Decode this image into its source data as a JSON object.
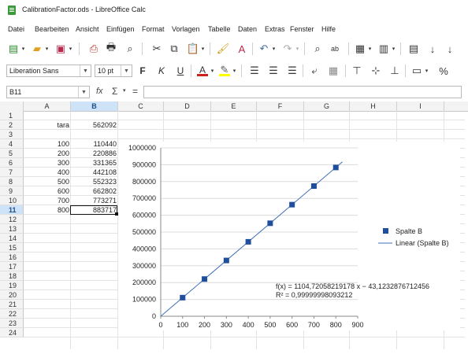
{
  "window": {
    "title": "CalibrationFactor.ods - LibreOffice Calc"
  },
  "menu": [
    "Datei",
    "Bearbeiten",
    "Ansicht",
    "Einfügen",
    "Format",
    "Vorlagen",
    "Tabelle",
    "Daten",
    "Extras",
    "Fenster",
    "Hilfe"
  ],
  "toolbar2": {
    "font_name": "Liberation Sans",
    "font_size": "10 pt",
    "bold": "F",
    "italic": "K",
    "underline": "U",
    "percent": "%"
  },
  "formula_bar": {
    "cell_ref": "B11",
    "fx": "fx",
    "sigma": "Σ",
    "equals": "=",
    "content": ""
  },
  "grid": {
    "columns": [
      "A",
      "B",
      "C",
      "D",
      "E",
      "F",
      "G",
      "H",
      "I"
    ],
    "active_column": "B",
    "rows": [
      "1",
      "2",
      "3",
      "4",
      "5",
      "6",
      "7",
      "8",
      "9",
      "10",
      "11",
      "12",
      "13",
      "14",
      "15",
      "16",
      "17",
      "18",
      "19",
      "20",
      "21",
      "22",
      "23",
      "24"
    ],
    "active_row": "11",
    "col_a": [
      "",
      "tara",
      "",
      "100",
      "200",
      "300",
      "400",
      "500",
      "600",
      "700",
      "800"
    ],
    "col_b": [
      "",
      "562092",
      "",
      "110440",
      "220886",
      "331365",
      "442108",
      "552323",
      "662802",
      "773271",
      "883717"
    ]
  },
  "chart_data": {
    "type": "scatter",
    "x_ticks": [
      "0",
      "100",
      "200",
      "300",
      "400",
      "500",
      "600",
      "700",
      "800",
      "900"
    ],
    "y_ticks": [
      "0",
      "100000",
      "200000",
      "300000",
      "400000",
      "500000",
      "600000",
      "700000",
      "800000",
      "900000",
      "1000000"
    ],
    "xlim": [
      0,
      900
    ],
    "ylim": [
      0,
      1000000
    ],
    "series": [
      {
        "name": "Spalte B",
        "color": "#1f4e9c",
        "x": [
          100,
          200,
          300,
          400,
          500,
          600,
          700,
          800
        ],
        "y": [
          110440,
          220886,
          331365,
          442108,
          552323,
          662802,
          773271,
          883717
        ]
      }
    ],
    "trendline": {
      "name": "Linear (Spalte B)",
      "color": "#3f6fb5",
      "slope": 1104.72058219178,
      "intercept": -43.1232876712456
    },
    "equation": "f(x) = 1104,72058219178 x − 43,1232876712456",
    "r_squared": "R² = 0,99999998093212",
    "legend_position": "right"
  }
}
